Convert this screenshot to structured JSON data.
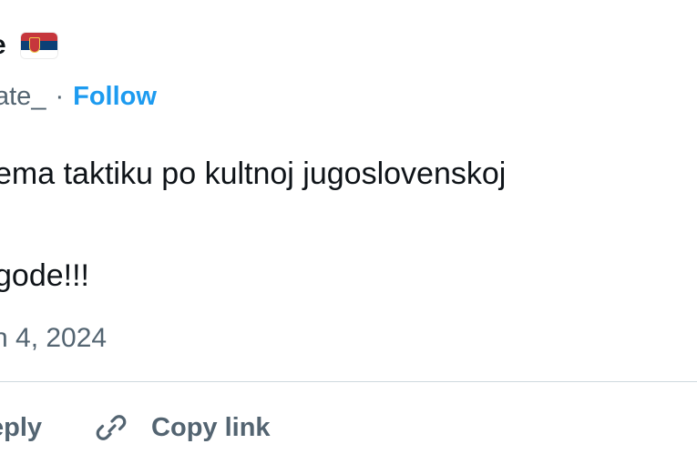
{
  "author": {
    "name_fragment": "e",
    "flag": "serbia-flag",
    "handle_fragment": "ate_",
    "separator": "·",
    "follow_label": "Follow"
  },
  "tweet": {
    "line1": "ema taktiku po kultnoj jugoslovenskoj",
    "line2": "gode!!!",
    "date": "n 4, 2024"
  },
  "actions": {
    "reply_label": "eply",
    "copy_link_label": "Copy link",
    "copy_link_icon": "link-icon"
  },
  "colors": {
    "text": "#0f1419",
    "secondary": "#536471",
    "accent": "#1d9bf0",
    "divider": "#cfd9de"
  }
}
